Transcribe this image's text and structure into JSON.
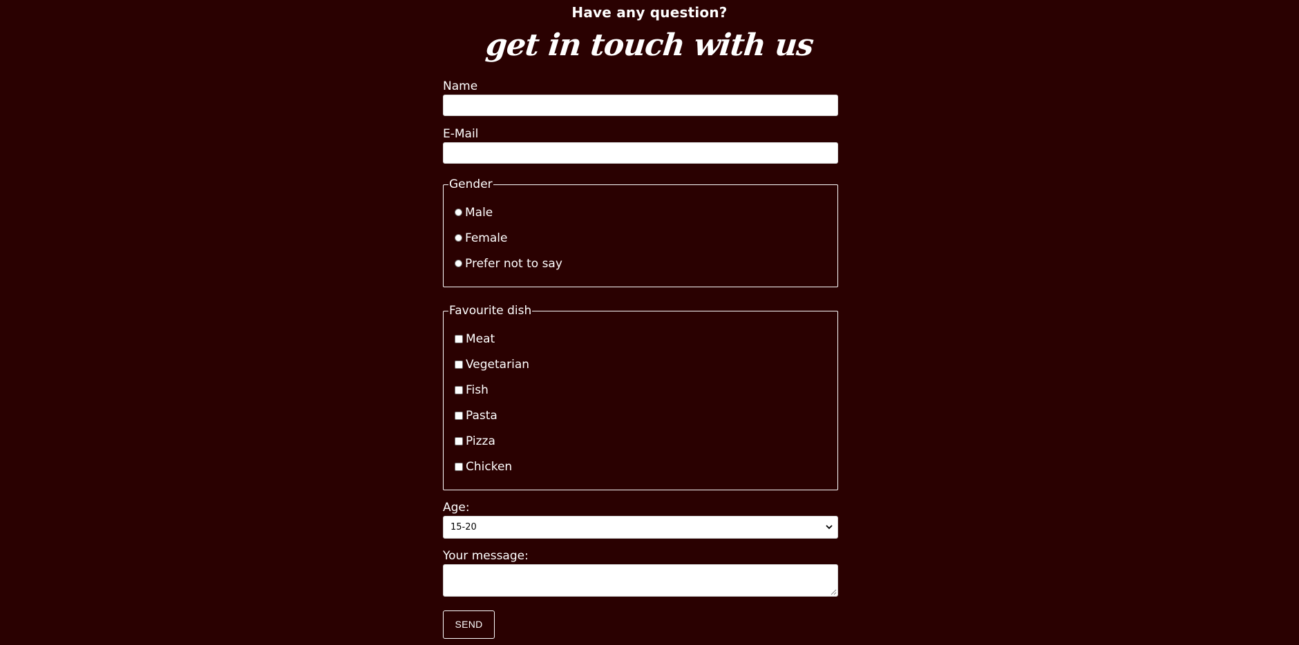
{
  "header": {
    "kicker": "Have any question?",
    "title": "get in touch with us"
  },
  "form": {
    "name_label": "Name",
    "name_value": "",
    "email_label": "E-Mail",
    "email_value": "",
    "gender": {
      "legend": "Gender",
      "options": [
        "Male",
        "Female",
        "Prefer not to say"
      ],
      "selected": null
    },
    "dish": {
      "legend": "Favourite dish",
      "options": [
        "Meat",
        "Vegetarian",
        "Fish",
        "Pasta",
        "Pizza",
        "Chicken"
      ],
      "checked": []
    },
    "age_label": "Age:",
    "age_selected": "15-20",
    "message_label": "Your message:",
    "message_value": "",
    "send_label": "SEND"
  },
  "colors": {
    "background": "#2a0101",
    "text": "#ffffff",
    "input_background": "#ffffff"
  },
  "icons": {
    "select_arrow": "chevron-down-icon",
    "textarea_grip": "resize-handle-icon"
  }
}
